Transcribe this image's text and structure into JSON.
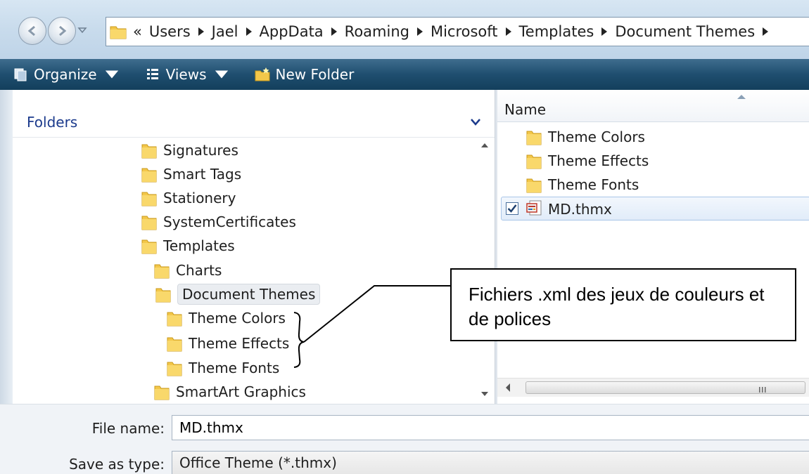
{
  "address": {
    "overflow": "«",
    "crumbs": [
      "Users",
      "Jael",
      "AppData",
      "Roaming",
      "Microsoft",
      "Templates",
      "Document Themes"
    ]
  },
  "toolbar": {
    "organize_label": "Organize",
    "views_label": "Views",
    "new_folder_label": "New Folder"
  },
  "folder_pane": {
    "header": "Folders",
    "items": [
      {
        "label": "Signatures"
      },
      {
        "label": "Smart Tags"
      },
      {
        "label": "Stationery"
      },
      {
        "label": "SystemCertificates"
      },
      {
        "label": "Templates"
      },
      {
        "label": "Charts"
      },
      {
        "label": "Document Themes"
      },
      {
        "label": "Theme Colors"
      },
      {
        "label": "Theme Effects"
      },
      {
        "label": "Theme Fonts"
      },
      {
        "label": "SmartArt Graphics"
      }
    ]
  },
  "file_pane": {
    "column_name": "Name",
    "folders": [
      {
        "label": "Theme Colors"
      },
      {
        "label": "Theme Effects"
      },
      {
        "label": "Theme Fonts"
      }
    ],
    "file": {
      "label": "MD.thmx",
      "checked": true
    }
  },
  "form": {
    "file_name_label": "File name:",
    "file_name_value": "MD.thmx",
    "save_type_label": "Save as type:",
    "save_type_value": "Office Theme (*.thmx)"
  },
  "callout": {
    "text": "Fichiers .xml des jeux de couleurs et de polices"
  },
  "colors": {
    "toolbar": "#1f4e6f",
    "folders_header": "#1b3a8c",
    "folder_yellow": "#f3c74a"
  }
}
